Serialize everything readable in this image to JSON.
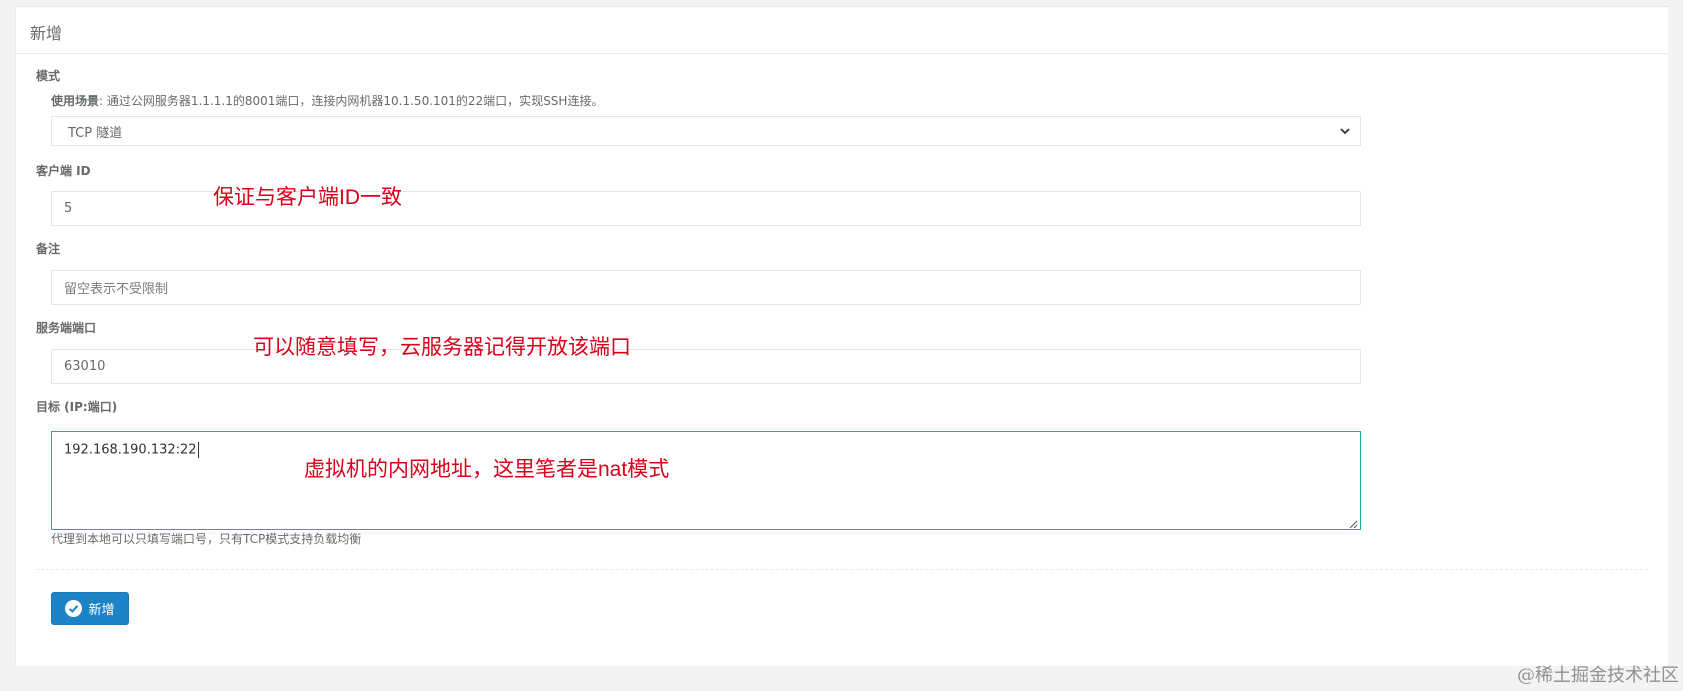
{
  "panel": {
    "title": "新增"
  },
  "mode": {
    "label": "模式",
    "hint_prefix": "使用场景",
    "hint_text": ": 通过公网服务器1.1.1.1的8001端口，连接内网机器10.1.50.101的22端口，实现SSH连接。",
    "selected": "TCP 隧道"
  },
  "client_id": {
    "label": "客户端 ID",
    "value": "5",
    "annotation": "保证与客户端ID一致"
  },
  "remark": {
    "label": "备注",
    "placeholder": "留空表示不受限制"
  },
  "server_port": {
    "label": "服务端端口",
    "value": "63010",
    "annotation": "可以随意填写，云服务器记得开放该端口"
  },
  "target": {
    "label": "目标 (IP:端口)",
    "value": "192.168.190.132:22",
    "annotation": "虚拟机的内网地址，这里笔者是nat模式",
    "help": "代理到本地可以只填写端口号，只有TCP模式支持负载均衡"
  },
  "submit": {
    "label": "新增"
  },
  "watermark": "@稀土掘金技术社区",
  "colors": {
    "accent_border": "#1ab394",
    "button": "#1c84c6",
    "annotation": "#d9001b"
  }
}
